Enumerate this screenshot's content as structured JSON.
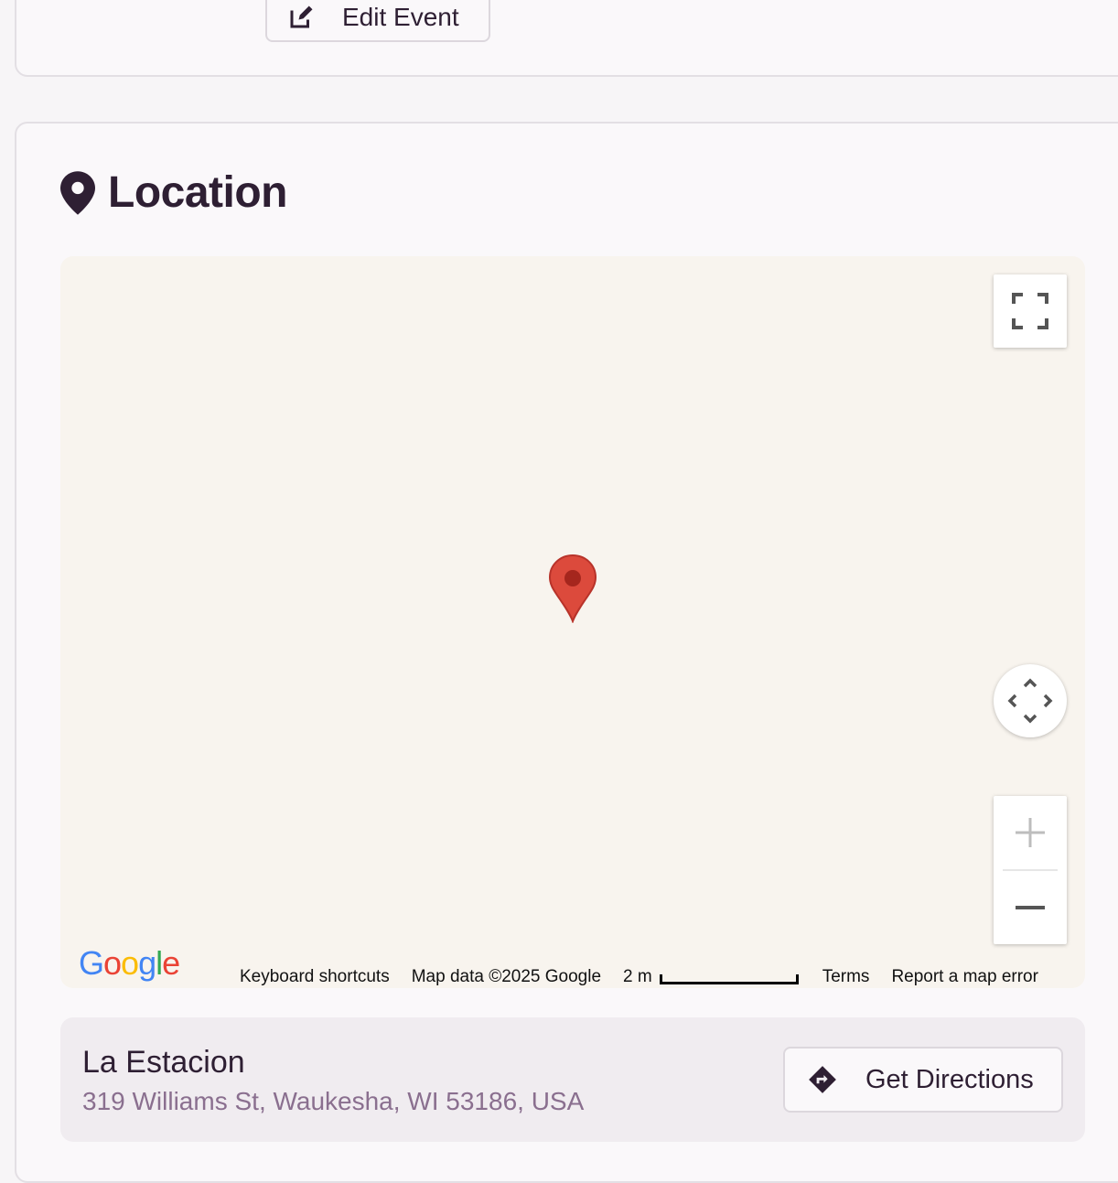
{
  "top_card": {
    "edit_event_label": "Edit Event"
  },
  "location": {
    "heading": "Location",
    "map": {
      "logo_text": "Google",
      "keyboard_shortcuts": "Keyboard shortcuts",
      "map_data": "Map data ©2025 Google",
      "scale_label": "2 m",
      "terms": "Terms",
      "report_error": "Report a map error"
    },
    "venue": {
      "name": "La Estacion",
      "address": "319 Williams St, Waukesha, WI 53186, USA",
      "directions_label": "Get Directions"
    }
  },
  "colors": {
    "text_primary": "#2e1f33",
    "text_secondary": "#8a6f8f",
    "pin_red": "#dc4a3c",
    "map_background": "#f8f4ee"
  }
}
